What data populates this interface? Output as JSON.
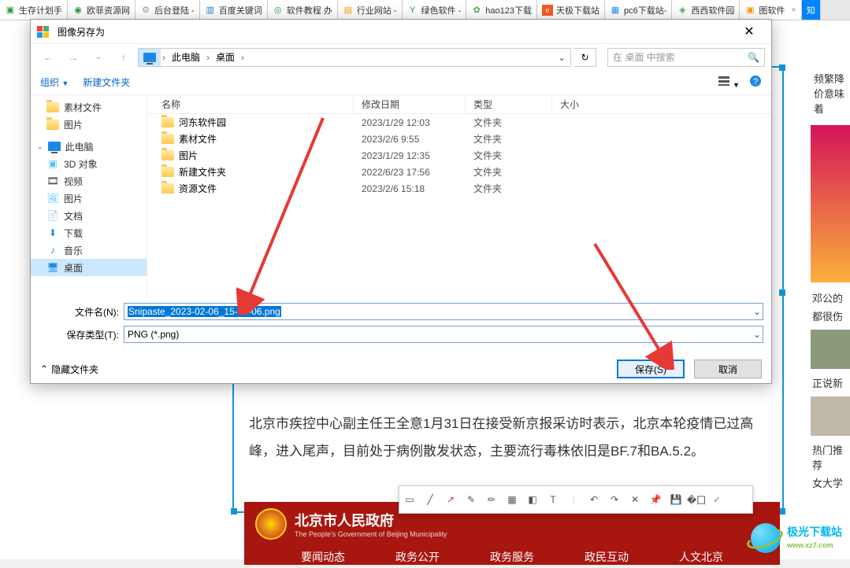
{
  "browser_tabs": [
    {
      "label": "生存计划手",
      "color": "#2a9d3e"
    },
    {
      "label": "欧菲资源网",
      "color": "#2a9d3e"
    },
    {
      "label": "后台登陆 -",
      "color": "#999"
    },
    {
      "label": "百度关键词",
      "color": "#1e88e5"
    },
    {
      "label": "软件教程 办",
      "color": "#2a9d3e"
    },
    {
      "label": "行业网站 -",
      "color": "#ff9800"
    },
    {
      "label": "绿色软件 -",
      "color": "#2a9d3e"
    },
    {
      "label": "hao123下载",
      "color": "#4caf50"
    },
    {
      "label": "天极下载站",
      "color": "#ff5722"
    },
    {
      "label": "pc6下载站-",
      "color": "#2196f3"
    },
    {
      "label": "西西软件园",
      "color": "#4caf50"
    },
    {
      "label": "图软件",
      "color": "#ff9800",
      "close": true
    },
    {
      "label": "知",
      "color": "#0084ff"
    }
  ],
  "dialog": {
    "title": "图像另存为",
    "breadcrumb": {
      "pc": "此电脑",
      "desktop": "桌面"
    },
    "search_placeholder": "在 桌面 中搜索",
    "toolbar": {
      "organize": "组织",
      "newfolder": "新建文件夹"
    },
    "sidebar": {
      "materials": "素材文件",
      "pictures1": "图片",
      "thispc": "此电脑",
      "three_d": "3D 对象",
      "videos": "视频",
      "pictures2": "图片",
      "documents": "文档",
      "downloads": "下载",
      "music": "音乐",
      "desktop": "桌面"
    },
    "columns": {
      "name": "名称",
      "date": "修改日期",
      "type": "类型",
      "size": "大小"
    },
    "rows": [
      {
        "name": "河东软件园",
        "date": "2023/1/29 12:03",
        "type": "文件夹"
      },
      {
        "name": "素材文件",
        "date": "2023/2/6 9:55",
        "type": "文件夹"
      },
      {
        "name": "图片",
        "date": "2023/1/29 12:35",
        "type": "文件夹"
      },
      {
        "name": "新建文件夹",
        "date": "2022/6/23 17:56",
        "type": "文件夹"
      },
      {
        "name": "资源文件",
        "date": "2023/2/6 15:18",
        "type": "文件夹"
      }
    ],
    "filename_label": "文件名(N):",
    "filename_value": "Snipaste_2023-02-06_15-30-06.png",
    "filetype_label": "保存类型(T):",
    "filetype_value": "PNG (*.png)",
    "hide_folders": "隐藏文件夹",
    "save_btn": "保存(S)",
    "cancel_btn": "取消"
  },
  "article": {
    "p1": "北京市疾控中心副主任王全意1月31日在接受新京报采访时表示，北京本轮疫情已过高峰，进入尾声，目前处于病例散发状态，主要流行毒株依旧是BF.7和BA.5.2。"
  },
  "gov": {
    "title": "北京市人民政府",
    "subtitle": "The People's Government of Beijing Municipality",
    "nav1": "要闻动态",
    "nav2": "政务公开",
    "nav3": "政务服务",
    "nav4": "政民互动",
    "nav5": "人文北京"
  },
  "right_sidebar": {
    "t1": "频繁降价意味着",
    "t2": "邓公的",
    "t3": "都很伤",
    "t4": "正说新",
    "t5": "女大学",
    "t6": "热门推荐"
  },
  "watermark": {
    "main": "极光下载站",
    "sub": "www.xz7.com"
  }
}
